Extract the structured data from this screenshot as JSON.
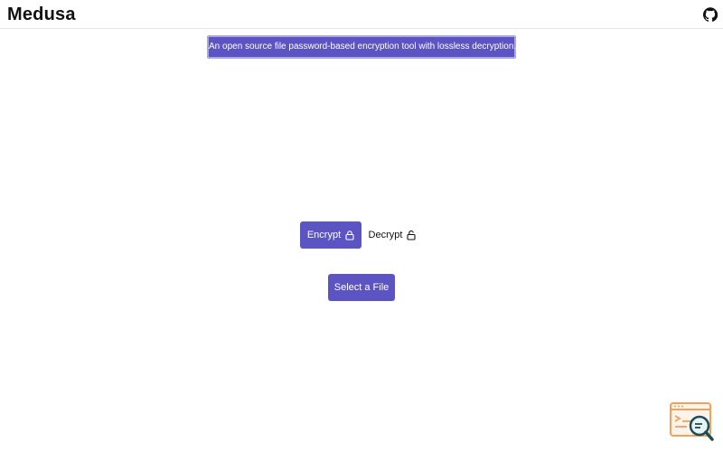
{
  "header": {
    "brand": "Medusa",
    "github_icon": "github-icon"
  },
  "tagline": "An open source file password-based encryption tool with lossless decryption.",
  "mode": {
    "encrypt_label": "Encrypt",
    "decrypt_label": "Decrypt",
    "selected": "encrypt",
    "icon": "lock-icon"
  },
  "actions": {
    "select_file_label": "Select a File"
  },
  "corner": {
    "icon": "terminal-search-icon"
  },
  "colors": {
    "accent": "#5b54c2",
    "accent_border": "#a9a7f0",
    "corner_orange": "#f0a15a",
    "corner_teal": "#1f4d57"
  }
}
